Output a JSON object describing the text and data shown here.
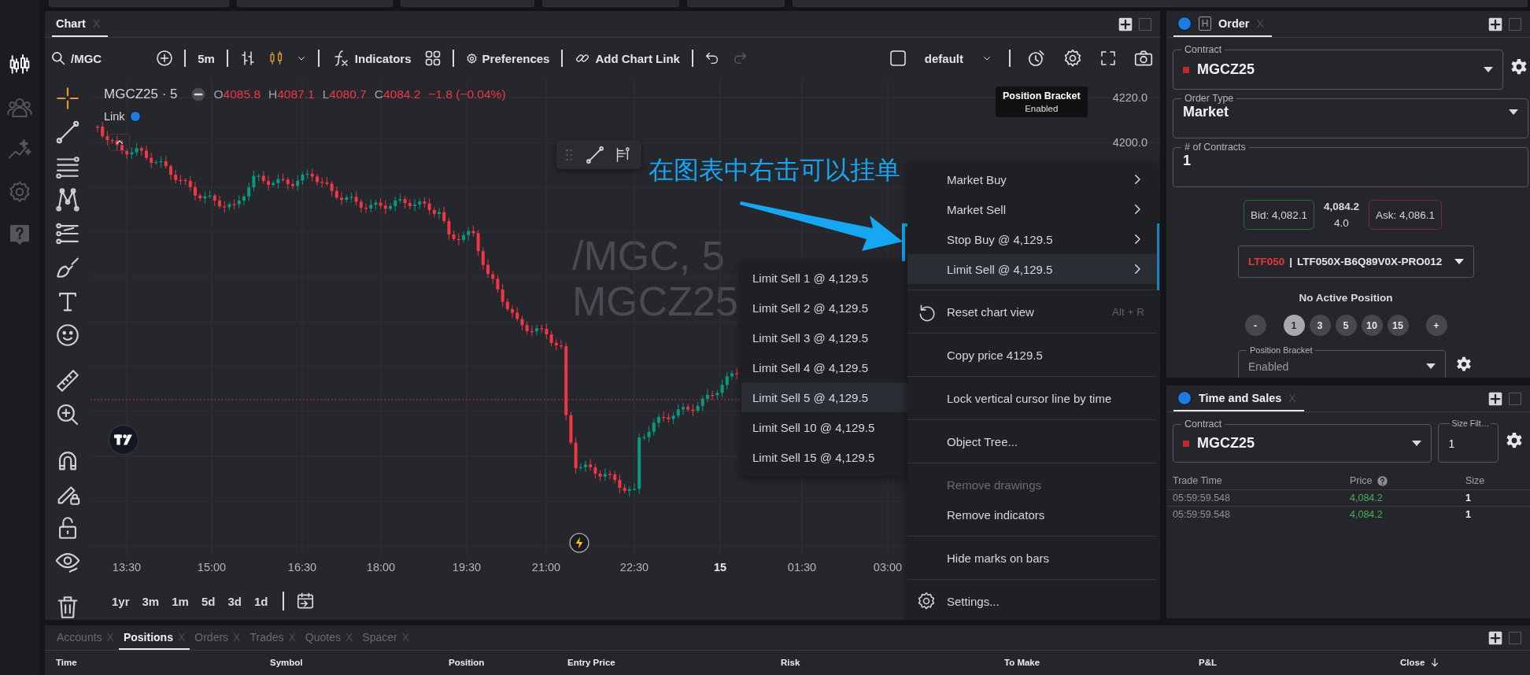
{
  "app_rail": [
    {
      "kind": "chart",
      "selected": true
    },
    {
      "kind": "people",
      "selected": false
    },
    {
      "kind": "sparkle",
      "selected": false
    },
    {
      "kind": "settings",
      "selected": false
    },
    {
      "kind": "help",
      "selected": false
    }
  ],
  "chart_panel": {
    "tab": {
      "label": "Chart",
      "close": "X",
      "selected": true
    },
    "toolbar": {
      "symbol": "/MGC",
      "interval": "5m",
      "indicators": "Indicators",
      "preferences": "Preferences",
      "chart_link": "Add Chart Link",
      "layout": "default"
    },
    "drawing_tools": [
      [
        {
          "kind": "crosshair",
          "selected": true
        },
        {
          "kind": "trendline",
          "selected": false
        },
        {
          "kind": "channel",
          "selected": false
        },
        {
          "kind": "pattern",
          "selected": false
        },
        {
          "kind": "levels",
          "selected": false
        },
        {
          "kind": "brush",
          "selected": false
        },
        {
          "kind": "text",
          "selected": false
        },
        {
          "kind": "emoji",
          "selected": false
        }
      ],
      [
        {
          "kind": "ruler",
          "selected": false
        },
        {
          "kind": "zoom",
          "selected": false
        }
      ],
      [
        {
          "kind": "magnet",
          "selected": false
        },
        {
          "kind": "drawlock",
          "selected": false
        },
        {
          "kind": "lock",
          "selected": false
        },
        {
          "kind": "eye",
          "selected": false
        }
      ],
      [
        {
          "kind": "trash",
          "selected": false
        }
      ]
    ],
    "legend": {
      "symbol": "MGCZ25 · 5",
      "ohlc": [
        {
          "letter": "O",
          "value": "4085.8"
        },
        {
          "letter": "H",
          "value": "4087.1"
        },
        {
          "letter": "L",
          "value": "4080.7"
        },
        {
          "letter": "C",
          "value": "4084.2"
        }
      ],
      "change": "−1.8 (−0.04%)"
    },
    "link": "Link",
    "tooltip": {
      "title": "Position Bracket",
      "value": "Enabled"
    },
    "watermark": [
      "/MGC, 5",
      "MGCZ25"
    ],
    "price_axis": [
      "4220.0",
      "4200.0"
    ],
    "time_axis": [
      {
        "label": "13:30",
        "kind": "time"
      },
      {
        "label": "15:00",
        "kind": "time"
      },
      {
        "label": "16:30",
        "kind": "time"
      },
      {
        "label": "18:00",
        "kind": "time"
      },
      {
        "label": "19:30",
        "kind": "time"
      },
      {
        "label": "21:00",
        "kind": "time"
      },
      {
        "label": "22:30",
        "kind": "time"
      },
      {
        "label": "15",
        "kind": "day"
      },
      {
        "label": "01:30",
        "kind": "time"
      },
      {
        "label": "03:00",
        "kind": "time"
      }
    ],
    "ranges": [
      "1yr",
      "3m",
      "1m",
      "5d",
      "3d",
      "1d"
    ],
    "context_menu": [
      [
        {
          "label": "Market Buy",
          "kind": "submenu",
          "selected": false,
          "disabled": false
        },
        {
          "label": "Market Sell",
          "kind": "submenu",
          "selected": false,
          "disabled": false
        },
        {
          "label": "Stop Buy @ 4,129.5",
          "kind": "submenu",
          "selected": false,
          "disabled": false
        },
        {
          "label": "Limit Sell @ 4,129.5",
          "kind": "submenu",
          "selected": true,
          "disabled": false
        }
      ],
      [
        {
          "label": "Reset chart view",
          "kind": "reset",
          "shortcut": "Alt + R",
          "selected": false,
          "disabled": false
        }
      ],
      [
        {
          "label": "Copy price 4129.5",
          "kind": "plain",
          "selected": false,
          "disabled": false
        }
      ],
      [
        {
          "label": "Lock vertical cursor line by time",
          "kind": "plain",
          "selected": false,
          "disabled": false
        }
      ],
      [
        {
          "label": "Object Tree...",
          "kind": "plain",
          "selected": false,
          "disabled": false
        }
      ],
      [
        {
          "label": "Remove drawings",
          "kind": "plain",
          "selected": false,
          "disabled": true
        },
        {
          "label": "Remove indicators",
          "kind": "plain",
          "selected": false,
          "disabled": false
        }
      ],
      [
        {
          "label": "Hide marks on bars",
          "kind": "plain",
          "selected": false,
          "disabled": false
        }
      ],
      [
        {
          "label": "Settings...",
          "kind": "settings",
          "selected": false,
          "disabled": false
        }
      ]
    ],
    "submenu": [
      {
        "label": "Limit Sell 1 @ 4,129.5",
        "selected": false
      },
      {
        "label": "Limit Sell 2 @ 4,129.5",
        "selected": false
      },
      {
        "label": "Limit Sell 3 @ 4,129.5",
        "selected": false
      },
      {
        "label": "Limit Sell 4 @ 4,129.5",
        "selected": false
      },
      {
        "label": "Limit Sell 5 @ 4,129.5",
        "selected": true
      },
      {
        "label": "Limit Sell 10 @ 4,129.5",
        "selected": false
      },
      {
        "label": "Limit Sell 15 @ 4,129.5",
        "selected": false
      }
    ],
    "annotation": "在图表中右击可以挂单"
  },
  "order_panel": {
    "tab": {
      "label": "Order",
      "badge": "H",
      "close": "X",
      "selected": true
    },
    "contract": {
      "label": "Contract",
      "value": "MGCZ25"
    },
    "order_type": {
      "label": "Order Type",
      "value": "Market"
    },
    "contracts": {
      "label": "# of Contracts",
      "value": "1"
    },
    "quote": {
      "bid": "Bid: 4,082.1",
      "last": "4,084.2",
      "change": "4.0",
      "ask": "Ask: 4,086.1"
    },
    "account": {
      "code": "LTF050",
      "separator": "|",
      "name": "LTF050X-B6Q89V0X-PRO012"
    },
    "position_status": "No Active Position",
    "quantity_buttons": [
      {
        "label": "-",
        "kind": "step",
        "selected": false
      },
      {
        "label": "1",
        "kind": "preset",
        "selected": true
      },
      {
        "label": "3",
        "kind": "preset",
        "selected": false
      },
      {
        "label": "5",
        "kind": "preset",
        "selected": false
      },
      {
        "label": "10",
        "kind": "preset",
        "selected": false
      },
      {
        "label": "15",
        "kind": "preset",
        "selected": false
      },
      {
        "label": "+",
        "kind": "step",
        "selected": false
      }
    ],
    "position_bracket": {
      "label": "Position Bracket",
      "value": "Enabled",
      "disabled": true
    }
  },
  "time_and_sales": {
    "tab": {
      "label": "Time and Sales",
      "close": "X",
      "selected": true
    },
    "contract": {
      "label": "Contract",
      "value": "MGCZ25"
    },
    "size_filter": {
      "label": "Size Filt…",
      "value": "1"
    },
    "columns": [
      "Trade Time",
      "Price",
      "Size"
    ],
    "rows": [
      [
        "05:59:59.548",
        "4,084.2",
        "1"
      ],
      [
        "05:59:59.548",
        "4,084.2",
        "1"
      ]
    ]
  },
  "bottom_panel": {
    "tabs": [
      {
        "label": "Accounts",
        "close": "X",
        "selected": false
      },
      {
        "label": "Positions",
        "close": "X",
        "selected": true
      },
      {
        "label": "Orders",
        "close": "X",
        "selected": false
      },
      {
        "label": "Trades",
        "close": "X",
        "selected": false
      },
      {
        "label": "Quotes",
        "close": "X",
        "selected": false
      },
      {
        "label": "Spacer",
        "close": "X",
        "selected": false
      }
    ],
    "columns": [
      "Time",
      "Symbol",
      "Position",
      "Entry Price",
      "Risk",
      "To Make",
      "P&L",
      "Close"
    ]
  }
}
